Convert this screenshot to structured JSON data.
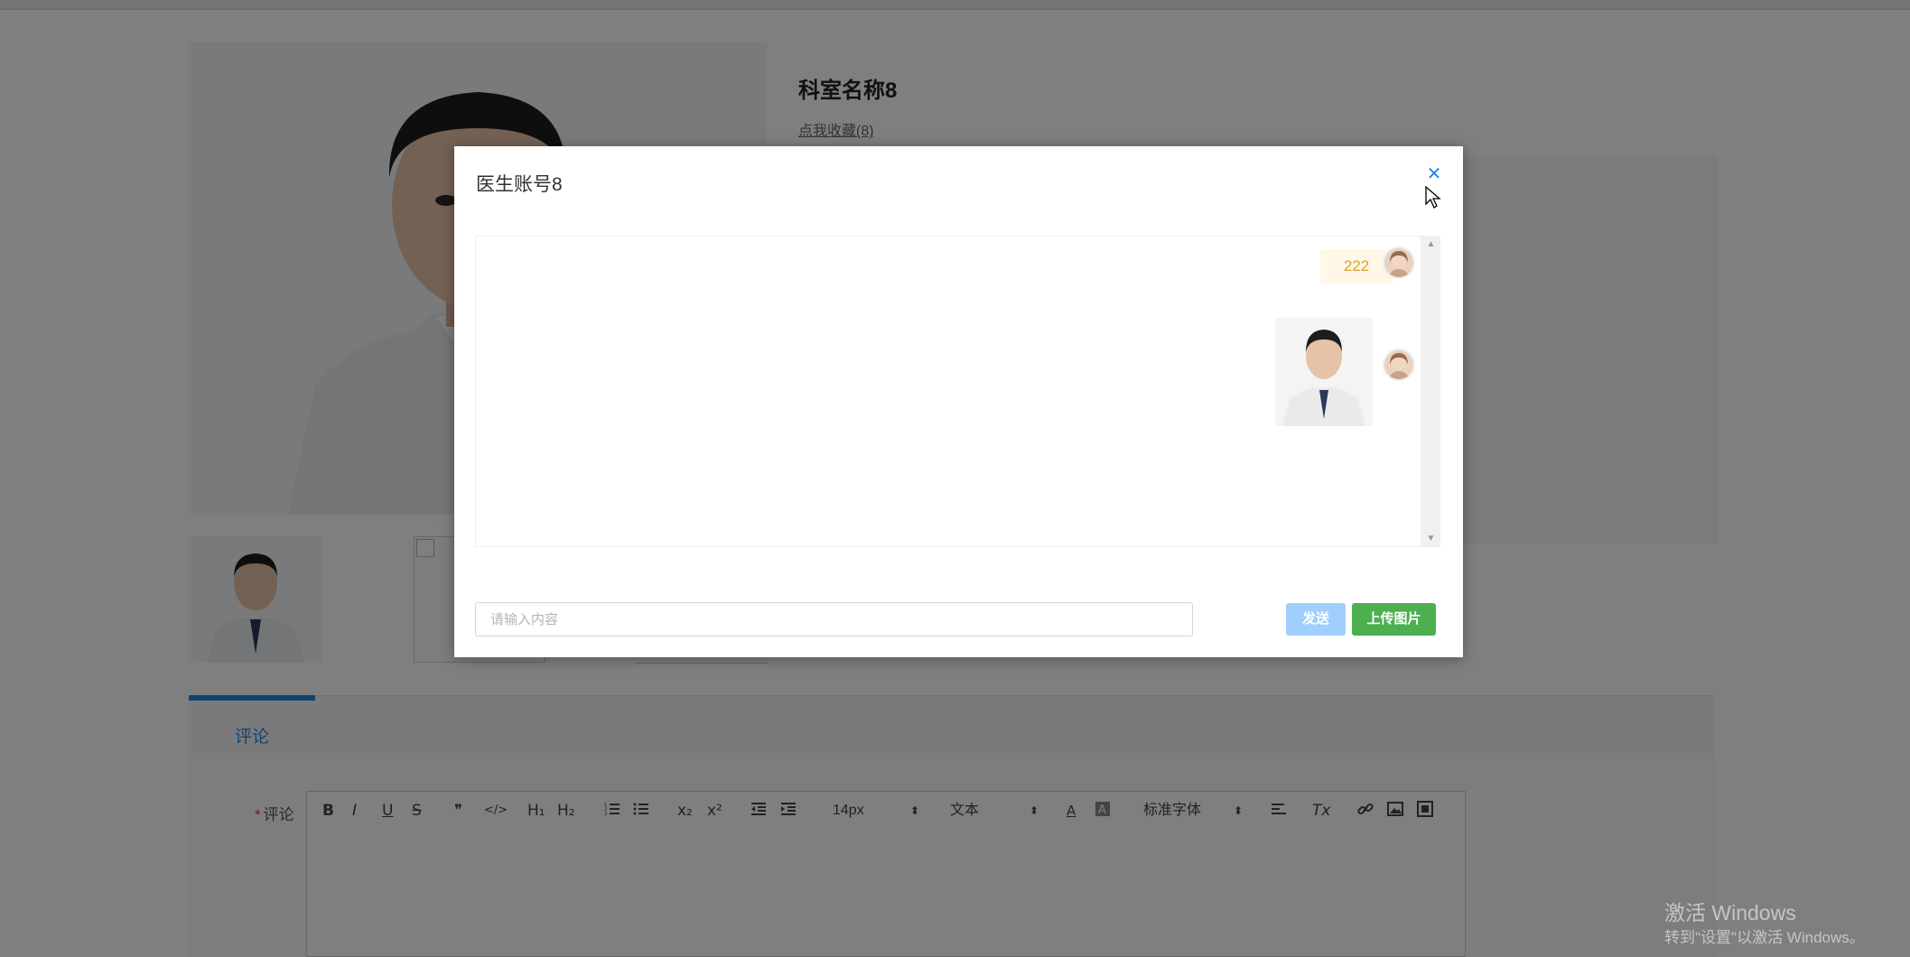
{
  "page": {
    "department_title": "科室名称8",
    "favorites_link": "点我收藏(8)"
  },
  "tabs": {
    "active_label": "评论"
  },
  "comment": {
    "label": "评论",
    "required_mark": "*"
  },
  "editor_toolbar": {
    "bold": "B",
    "italic": "I",
    "underline": "U",
    "strike": "S",
    "quote": "❞",
    "code": "</>",
    "h1": "H₁",
    "h2": "H₂",
    "subscript": "x₂",
    "superscript": "x²",
    "font_size": "14px",
    "text_type": "文本",
    "font_family": "标准字体",
    "clear_format": "Tx"
  },
  "chat_modal": {
    "title": "医生账号8",
    "messages": [
      {
        "type": "text",
        "text": "222"
      },
      {
        "type": "image"
      }
    ],
    "input_placeholder": "请输入内容",
    "input_value": "",
    "send_label": "发送",
    "upload_label": "上传图片"
  },
  "watermark": {
    "line1": "激活 Windows",
    "line2": "转到\"设置\"以激活 Windows。"
  },
  "colors": {
    "accent": "#1e88e5",
    "send_disabled": "#a0cfff",
    "upload": "#4caf50",
    "bubble_bg": "#fff8e6",
    "bubble_text": "#d9a12c"
  }
}
